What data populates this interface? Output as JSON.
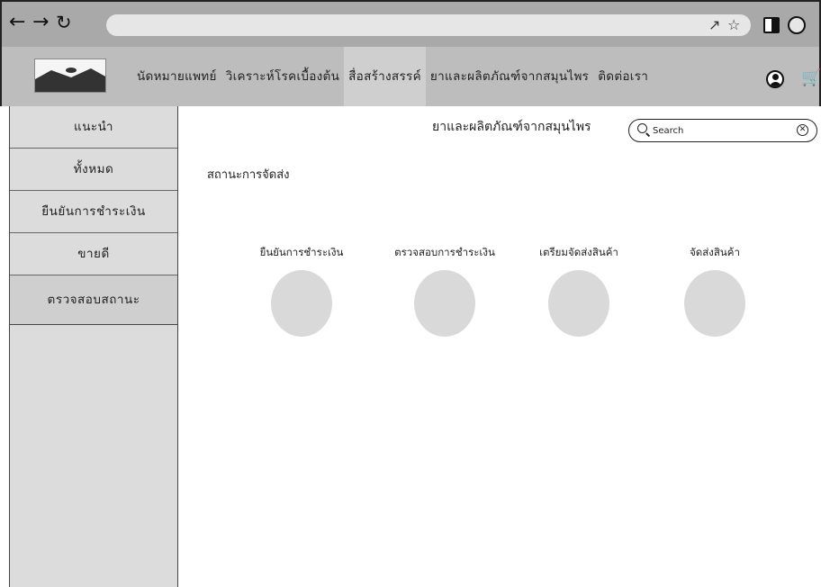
{
  "browser": {
    "back_icon": "arrow-left-icon",
    "forward_icon": "arrow-right-icon",
    "reload_icon": "reload-icon",
    "url": "",
    "icons": [
      "share-icon",
      "star-icon",
      "side-panel-icon",
      "profile-icon",
      "more-vertical-icon"
    ]
  },
  "header": {
    "logo": "image-placeholder-logo",
    "menu": [
      "นัดหมายแพทย์",
      "วิเคราะห์โรคเบื้องต้น",
      "สื่อสร้างสรรค์",
      "ยาและผลิตภัณฑ์จากสมุนไพร",
      "ติดต่อเรา"
    ],
    "active_menu_index": 2,
    "account_icon": "account-circle-icon",
    "cart_icon": "cart-icon"
  },
  "sidebar": {
    "items": [
      "แนะนำ",
      "ทั้งหมด",
      "ยืนยันการชำระเงิน",
      "ขายดี",
      "ตรวจสอบสถานะ"
    ]
  },
  "main": {
    "title": "ยาและผลิตภัณฑ์จากสมุนไพร",
    "search": {
      "placeholder": "Search"
    },
    "section_label": "สถานะการจัดส่ง",
    "steps": [
      "ยืนยันการชำระเงิน",
      "ตรวจสอบการชำระเงิน",
      "เตรียมจัดส่งสินค้า",
      "จัดส่งสินค้า"
    ]
  },
  "colors": {
    "chrome": "#a9a9a9",
    "header": "#bdbdbd",
    "sidebar": "#dcdcdc",
    "circle": "#d9d9d9"
  }
}
